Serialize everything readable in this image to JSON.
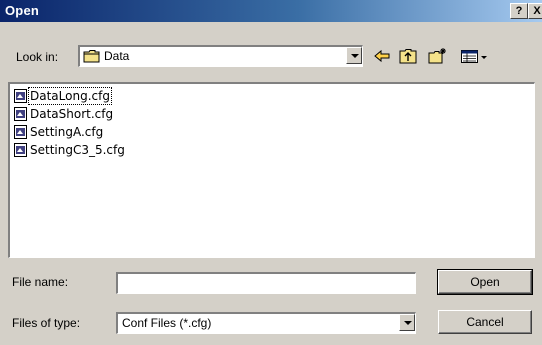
{
  "window": {
    "title": "Open",
    "help_label": "?",
    "close_label": "X"
  },
  "lookin": {
    "label": "Look in:",
    "value": "Data"
  },
  "toolbar": {
    "icons": [
      "back-arrow-icon",
      "up-one-level-icon",
      "new-folder-icon",
      "view-menu-icon"
    ]
  },
  "files": [
    {
      "name": "DataLong.cfg",
      "focused": true
    },
    {
      "name": "DataShort.cfg",
      "focused": false
    },
    {
      "name": "SettingA.cfg",
      "focused": false
    },
    {
      "name": "SettingC3_5.cfg",
      "focused": false
    }
  ],
  "filename": {
    "label": "File name:",
    "value": ""
  },
  "filetype": {
    "label": "Files of type:",
    "value": "Conf Files (*.cfg)"
  },
  "buttons": {
    "open_label": "Open",
    "cancel_label": "Cancel"
  },
  "colors": {
    "titlebar_start": "#0a246a",
    "titlebar_end": "#a6caf0",
    "dialog_bg": "#d4d0c8"
  }
}
